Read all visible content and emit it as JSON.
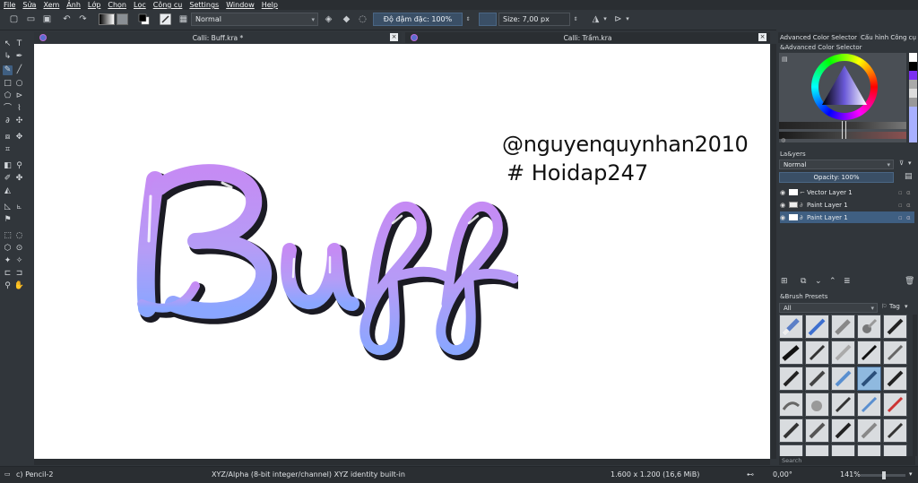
{
  "menu": [
    "File",
    "Sửa",
    "Xem",
    "Ảnh",
    "Lớp",
    "Chọn",
    "Lọc",
    "Công cụ",
    "Settings",
    "Window",
    "Help"
  ],
  "toolbar": {
    "blend_mode": "Normal",
    "opacity_label": "Độ đậm đặc: 100%",
    "size_label": "Size: 7,00 px"
  },
  "tabs": {
    "left": "Calli: Buff.kra *",
    "right": "Calli: Trầm.kra",
    "close_glyph": "×"
  },
  "canvas": {
    "handle_line1": "@nguyenquynhan2010",
    "handle_line2": "# Hoidap247",
    "lettering": "Buff",
    "colors": {
      "top": "#c58bf4",
      "bottom": "#8aa6ff",
      "outline": "#1b1b24"
    }
  },
  "right_panel": {
    "tab_active": "Advanced Color Selector",
    "tab_other": "Cấu hình Công cụ",
    "color_selector_title": "&Advanced Color Selector",
    "layers_title": "La&yers",
    "layers_blend": "Normal",
    "layers_opacity": "Opacity:  100%",
    "layers": [
      {
        "name": "Vector Layer 1",
        "selected": false
      },
      {
        "name": "Paint Layer 1",
        "selected": false
      },
      {
        "name": "Paint Layer 1",
        "selected": true
      }
    ],
    "presets_title": "&Brush Presets",
    "presets_filter": "All",
    "presets_tag": "Tag",
    "search_placeholder": "Search"
  },
  "status": {
    "brush": "c) Pencil-2",
    "color_space": "XYZ/Alpha (8-bit integer/channel)  XYZ identity built-in",
    "dimensions": "1.600 x 1.200 (16,6 MiB)",
    "rotation": "0,00°",
    "zoom": "141%"
  },
  "colors": {
    "accent": "#3f5f82",
    "panel_bg": "#31363b",
    "canvas_bg": "#ffffff"
  }
}
